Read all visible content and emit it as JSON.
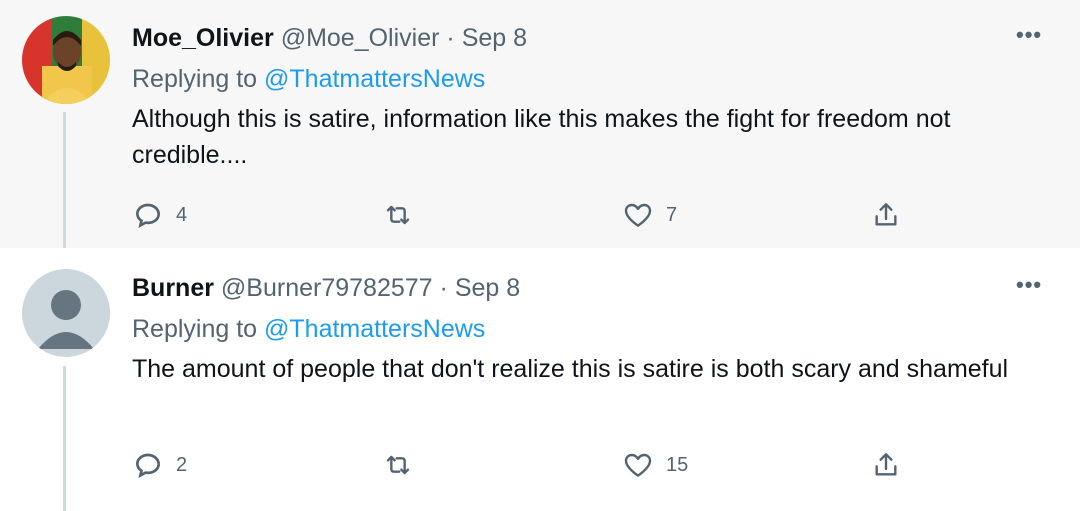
{
  "tweets": [
    {
      "display_name": "Moe_Olivier",
      "handle": "@Moe_Olivier",
      "separator": "·",
      "date": "Sep 8",
      "replying_prefix": "Replying to",
      "replying_to": "@ThatmattersNews",
      "text": "Although this is satire, information like this makes the fight for freedom not credible....",
      "more_label": "•••",
      "reply_count": "4",
      "retweet_count": "",
      "like_count": "7",
      "avatar_icon": "user-photo-avatar"
    },
    {
      "display_name": "Burner",
      "handle": "@Burner79782577",
      "separator": "·",
      "date": "Sep 8",
      "replying_prefix": "Replying to",
      "replying_to": "@ThatmattersNews",
      "text": "The amount of people that don't realize this is satire is both scary and shameful",
      "more_label": "•••",
      "reply_count": "2",
      "retweet_count": "",
      "like_count": "15",
      "avatar_icon": "default-user-avatar"
    }
  ],
  "colors": {
    "link": "#1d9bf0",
    "muted": "#536471",
    "text": "#0f1419",
    "thread_line": "#cfd9de",
    "first_bg": "#f7f7f7"
  }
}
